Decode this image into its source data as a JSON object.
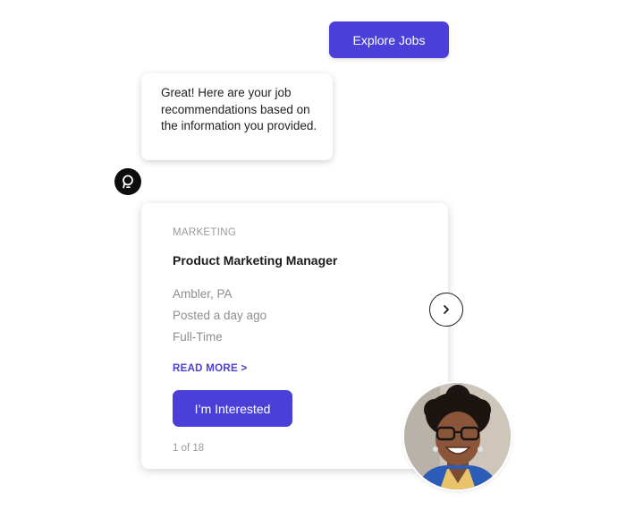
{
  "chat": {
    "user_message": "Explore Jobs",
    "bot_message": "Great! Here are your job recommendations based on the information you provided."
  },
  "job_card": {
    "category": "MARKETING",
    "title": "Product Marketing Manager",
    "location": "Ambler, PA",
    "posted": "Posted a day ago",
    "type": "Full-Time",
    "read_more_label": "READ MORE >",
    "interested_label": "I’m Interested",
    "pager": "1 of 18"
  },
  "icons": {
    "bot": "bot-logo-icon",
    "next": "chevron-right-icon"
  },
  "colors": {
    "accent": "#4a3fd8",
    "muted_text": "#9a9a9a",
    "bot_avatar_bg": "#0d0d0d"
  }
}
